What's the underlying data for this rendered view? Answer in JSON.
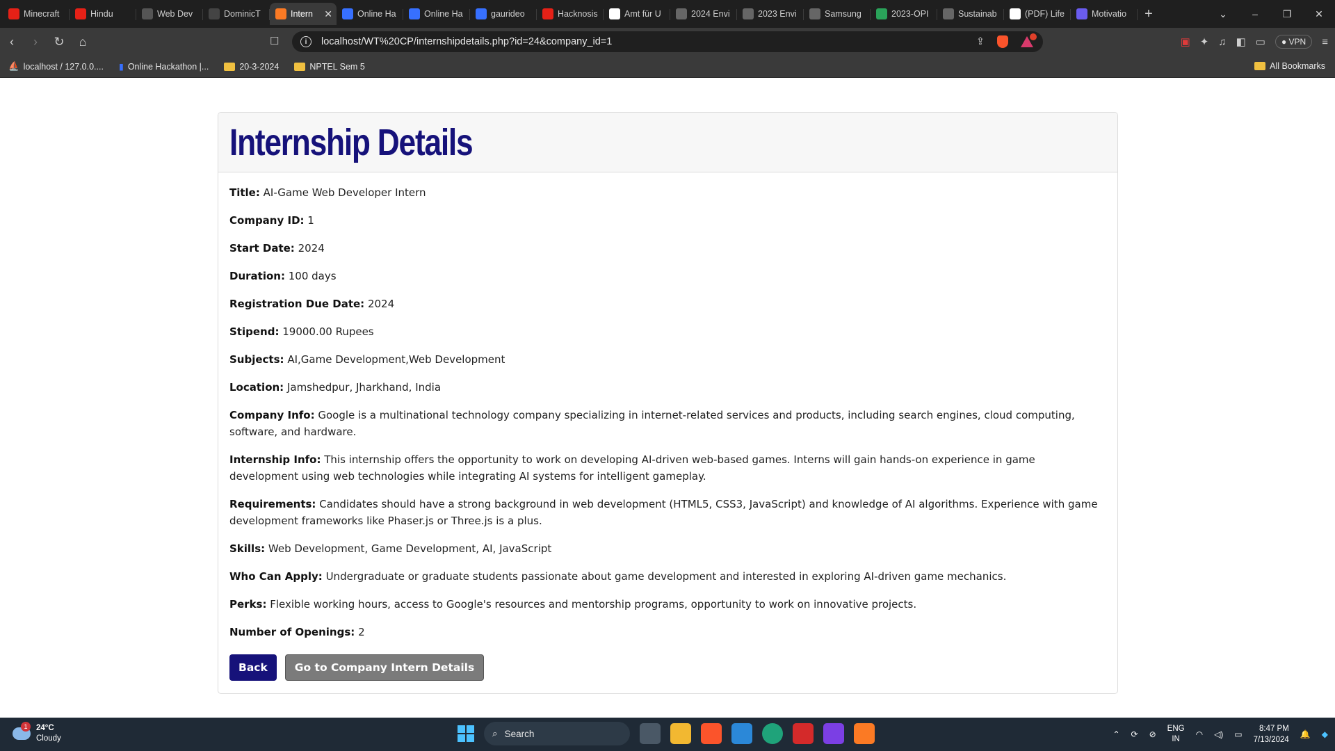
{
  "browser": {
    "tabs": [
      {
        "title": "Minecraft",
        "icon": "youtube-icon",
        "color": "#e62117"
      },
      {
        "title": "Hindu",
        "icon": "youtube-icon",
        "color": "#e62117"
      },
      {
        "title": "Web Dev",
        "icon": "openai-icon",
        "color": "#555555"
      },
      {
        "title": "DominicT",
        "icon": "github-icon",
        "color": "#444444"
      },
      {
        "title": "Intern",
        "icon": "xampp-icon",
        "color": "#fb7a24",
        "active": true
      },
      {
        "title": "Online Ha",
        "icon": "devfolio-icon",
        "color": "#3770ff"
      },
      {
        "title": "Online Ha",
        "icon": "devfolio-icon",
        "color": "#3770ff"
      },
      {
        "title": "gaurideo",
        "icon": "devfolio-icon",
        "color": "#3770ff"
      },
      {
        "title": "Hacknosis",
        "icon": "youtube-icon",
        "color": "#e62117"
      },
      {
        "title": "Amt für U",
        "icon": "amt-icon",
        "color": "#ffffff"
      },
      {
        "title": "2024 Envi",
        "icon": "globe-icon",
        "color": "#666666"
      },
      {
        "title": "2023 Envi",
        "icon": "globe-icon",
        "color": "#666666"
      },
      {
        "title": "Samsung",
        "icon": "globe-icon",
        "color": "#666666"
      },
      {
        "title": "2023-OPI",
        "icon": "circle-icon",
        "color": "#2aa35a"
      },
      {
        "title": "Sustainab",
        "icon": "globe-icon",
        "color": "#666666"
      },
      {
        "title": "(PDF) Life",
        "icon": "researchgate-icon",
        "color": "#ffffff"
      },
      {
        "title": "Motivatio",
        "icon": "shield-icon",
        "color": "#6a5cf0"
      }
    ],
    "tab_close": "✕",
    "new_tab": "+",
    "window_controls": {
      "minimize": "–",
      "maximize": "❐",
      "close": "✕",
      "dropdown": "⌄"
    },
    "url": "localhost/WT%20CP/internshipdetails.php?id=24&company_id=1",
    "vpn_label": "VPN",
    "bookmarks": [
      {
        "label": "localhost / 127.0.0....",
        "icon": "phpmyadmin-icon"
      },
      {
        "label": "Online Hackathon |...",
        "icon": "devfolio-icon"
      },
      {
        "label": "20-3-2024",
        "icon": "folder-icon"
      },
      {
        "label": "NPTEL Sem 5",
        "icon": "folder-icon"
      }
    ],
    "all_bookmarks": "All Bookmarks"
  },
  "page": {
    "heading": "Internship Details",
    "fields": [
      {
        "label": "Title:",
        "value": "AI-Game Web Developer Intern"
      },
      {
        "label": "Company ID:",
        "value": "1"
      },
      {
        "label": "Start Date:",
        "value": "2024"
      },
      {
        "label": "Duration:",
        "value": "100 days"
      },
      {
        "label": "Registration Due Date:",
        "value": "2024"
      },
      {
        "label": "Stipend:",
        "value": "19000.00 Rupees"
      },
      {
        "label": "Subjects:",
        "value": "AI,Game Development,Web Development"
      },
      {
        "label": "Location:",
        "value": "Jamshedpur, Jharkhand, India"
      },
      {
        "label": "Company Info:",
        "value": "Google is a multinational technology company specializing in internet-related services and products, including search engines, cloud computing, software, and hardware."
      },
      {
        "label": "Internship Info:",
        "value": "This internship offers the opportunity to work on developing AI-driven web-based games. Interns will gain hands-on experience in game development using web technologies while integrating AI systems for intelligent gameplay."
      },
      {
        "label": "Requirements:",
        "value": "Candidates should have a strong background in web development (HTML5, CSS3, JavaScript) and knowledge of AI algorithms. Experience with game development frameworks like Phaser.js or Three.js is a plus."
      },
      {
        "label": "Skills:",
        "value": "Web Development, Game Development, AI, JavaScript"
      },
      {
        "label": "Who Can Apply:",
        "value": "Undergraduate or graduate students passionate about game development and interested in exploring AI-driven game mechanics."
      },
      {
        "label": "Perks:",
        "value": "Flexible working hours, access to Google's resources and mentorship programs, opportunity to work on innovative projects."
      },
      {
        "label": "Number of Openings:",
        "value": "2"
      }
    ],
    "back_button": "Back",
    "company_button": "Go to Company Intern Details",
    "colors": {
      "heading": "#16127a",
      "back_button": "#16127a",
      "company_button": "#7b7b7b"
    }
  },
  "taskbar": {
    "weather_temp": "24°C",
    "weather_desc": "Cloudy",
    "weather_badge": "1",
    "search_placeholder": "Search",
    "language": "ENG",
    "region": "IN",
    "time": "8:47 PM",
    "date": "7/13/2024"
  }
}
